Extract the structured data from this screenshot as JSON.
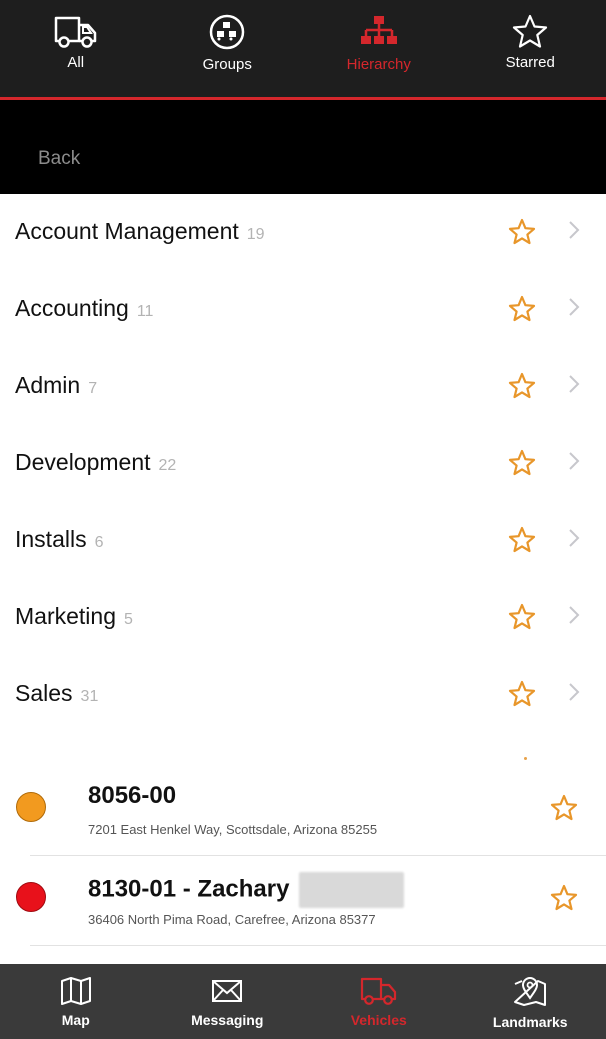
{
  "top_tabs": [
    {
      "label": "All",
      "icon": "truck-icon"
    },
    {
      "label": "Groups",
      "icon": "groups-icon"
    },
    {
      "label": "Hierarchy",
      "icon": "hierarchy-icon"
    },
    {
      "label": "Starred",
      "icon": "star-outline-icon"
    }
  ],
  "active_top_tab": "Hierarchy",
  "back_label": "Back",
  "groups": [
    {
      "name": "Account Management",
      "count": "19"
    },
    {
      "name": "Accounting",
      "count": "11"
    },
    {
      "name": "Admin",
      "count": "7"
    },
    {
      "name": "Development",
      "count": "22"
    },
    {
      "name": "Installs",
      "count": "6"
    },
    {
      "name": "Marketing",
      "count": "5"
    },
    {
      "name": "Sales",
      "count": "31"
    }
  ],
  "vehicles": [
    {
      "title": "8056-00",
      "address": "7201 East Henkel Way, Scottsdale, Arizona 85255",
      "status_color": "#f29a1f"
    },
    {
      "title": "8130-01 - Zachary",
      "address": "36406 North Pima Road, Carefree, Arizona 85377",
      "status_color": "#e8111b"
    }
  ],
  "bottom_tabs": [
    {
      "label": "Map",
      "icon": "map-icon"
    },
    {
      "label": "Messaging",
      "icon": "envelope-icon"
    },
    {
      "label": "Vehicles",
      "icon": "truck-icon"
    },
    {
      "label": "Landmarks",
      "icon": "landmark-pin-icon"
    }
  ],
  "active_bottom_tab": "Vehicles",
  "colors": {
    "accent": "#d4272c",
    "star": "#e8962a",
    "chevron": "#c7c7cc"
  }
}
